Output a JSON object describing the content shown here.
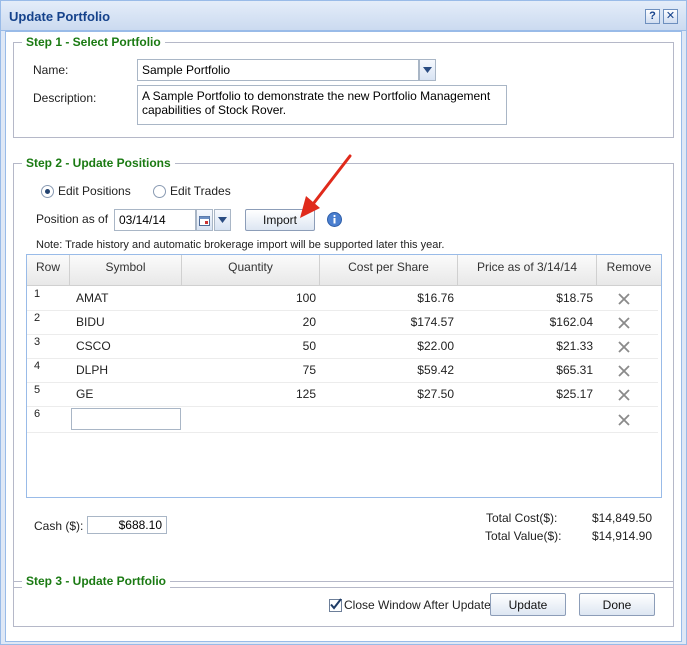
{
  "window": {
    "title": "Update Portfolio",
    "help_label": "?",
    "close_label": "✕"
  },
  "step1": {
    "legend": "Step 1 - Select Portfolio",
    "name_label": "Name:",
    "name_value": "Sample Portfolio",
    "description_label": "Description:",
    "description_value": "A Sample Portfolio to demonstrate the new Portfolio Management capabilities of Stock Rover."
  },
  "step2": {
    "legend": "Step 2 - Update Positions",
    "mode_edit_positions": "Edit Positions",
    "mode_edit_trades": "Edit Trades",
    "selected_mode": "edit_positions",
    "position_as_of_label": "Position as of",
    "position_date": "03/14/14",
    "import_label": "Import",
    "note": "Note: Trade history and automatic brokerage import will be supported later this year.",
    "columns": {
      "row": "Row",
      "symbol": "Symbol",
      "quantity": "Quantity",
      "cost": "Cost per Share",
      "price": "Price as of 3/14/14",
      "remove": "Remove"
    },
    "rows": [
      {
        "row": "1",
        "symbol": "AMAT",
        "quantity": "100",
        "cost": "$16.76",
        "price": "$18.75"
      },
      {
        "row": "2",
        "symbol": "BIDU",
        "quantity": "20",
        "cost": "$174.57",
        "price": "$162.04"
      },
      {
        "row": "3",
        "symbol": "CSCO",
        "quantity": "50",
        "cost": "$22.00",
        "price": "$21.33"
      },
      {
        "row": "4",
        "symbol": "DLPH",
        "quantity": "75",
        "cost": "$59.42",
        "price": "$65.31"
      },
      {
        "row": "5",
        "symbol": "GE",
        "quantity": "125",
        "cost": "$27.50",
        "price": "$25.17"
      }
    ],
    "new_row_number": "6",
    "cash_label": "Cash ($):",
    "cash_value": "$688.10",
    "total_cost_label": "Total Cost($):",
    "total_cost_value": "$14,849.50",
    "total_value_label": "Total Value($):",
    "total_value_value": "$14,914.90"
  },
  "step3": {
    "legend": "Step 3 - Update Portfolio",
    "close_after_update_label": "Close Window After Update",
    "close_after_update_checked": true,
    "update_label": "Update",
    "done_label": "Done"
  },
  "colors": {
    "legend_green": "#1a7a12",
    "title_blue": "#15428b",
    "annotation_arrow": "#e02a1b"
  },
  "icons": {
    "calendar": "calendar-icon",
    "dropdown": "chevron-down-icon",
    "info": "info-icon",
    "remove": "close-icon",
    "annotation": "red-arrow-icon"
  }
}
